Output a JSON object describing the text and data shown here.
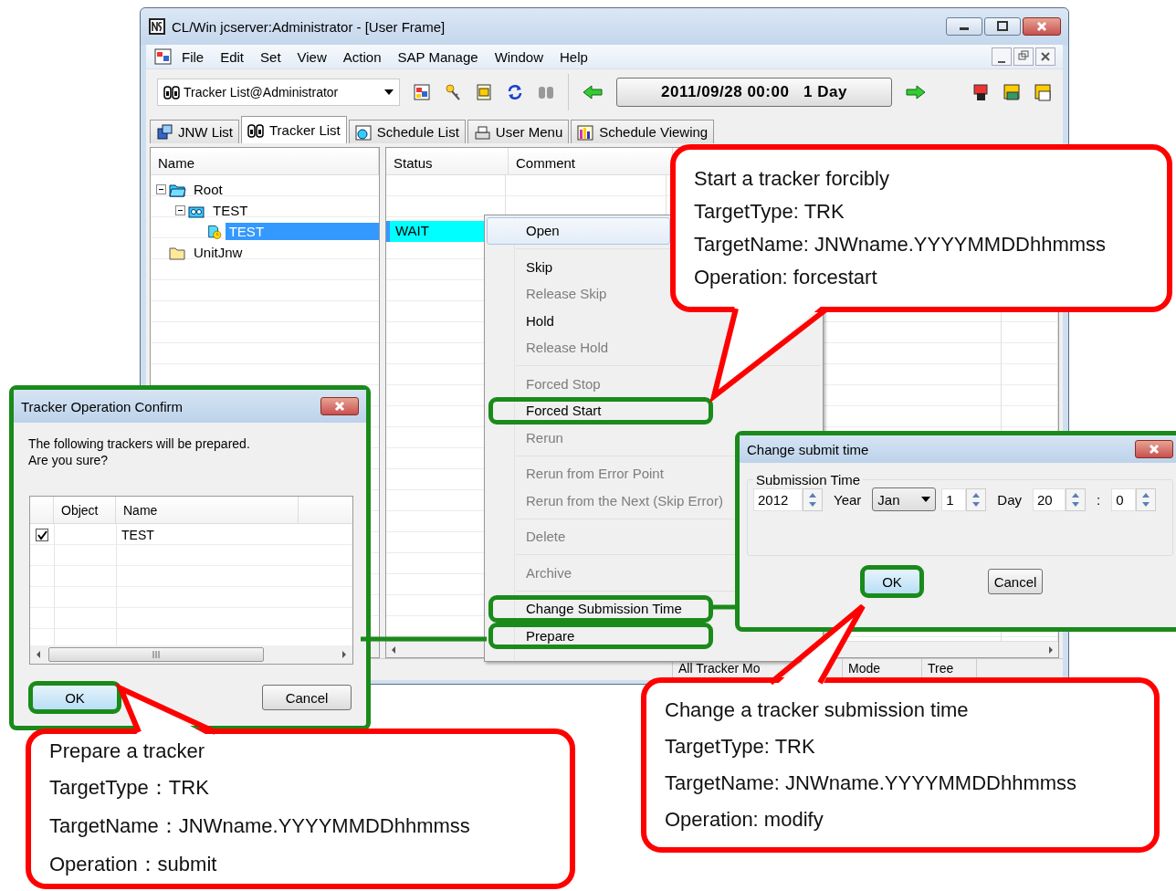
{
  "main_window": {
    "title": "CL/Win jcserver:Administrator - [User Frame]",
    "menu": [
      "File",
      "Edit",
      "Set",
      "View",
      "Action",
      "SAP Manage",
      "Window",
      "Help"
    ],
    "view_selector": "Tracker List@Administrator",
    "date_range": "2011/09/28 00:00   1 Day",
    "tabs": [
      {
        "label": "JNW List",
        "selected": false
      },
      {
        "label": "Tracker List",
        "selected": true
      },
      {
        "label": "Schedule List",
        "selected": false
      },
      {
        "label": "User Menu",
        "selected": false
      },
      {
        "label": "Schedule Viewing",
        "selected": false
      }
    ],
    "tree_column": "Name",
    "tree": [
      {
        "label": "Root",
        "kind": "root",
        "expanded": true,
        "selected": false,
        "children": [
          {
            "label": "TEST",
            "kind": "group",
            "expanded": true,
            "selected": false,
            "children": [
              {
                "label": "TEST",
                "kind": "tracker",
                "selected": true,
                "status": "WAIT"
              }
            ]
          }
        ]
      },
      {
        "label": "UnitJnw",
        "kind": "folder",
        "selected": false
      }
    ],
    "list_columns": [
      "Status",
      "Comment"
    ],
    "status_bar": [
      "All Tracker Mo",
      "Mode",
      "Tree"
    ]
  },
  "context_menu": {
    "items": [
      {
        "kind": "item",
        "label": "Open",
        "selected": true,
        "disabled": false,
        "marked": false
      },
      {
        "kind": "separator"
      },
      {
        "kind": "item",
        "label": "Skip",
        "selected": false,
        "disabled": false,
        "marked": false
      },
      {
        "kind": "item",
        "label": "Release Skip",
        "selected": false,
        "disabled": true,
        "marked": false
      },
      {
        "kind": "item",
        "label": "Hold",
        "selected": false,
        "disabled": false,
        "marked": false
      },
      {
        "kind": "item",
        "label": "Release Hold",
        "selected": false,
        "disabled": true,
        "marked": false
      },
      {
        "kind": "separator"
      },
      {
        "kind": "item",
        "label": "Forced Stop",
        "selected": false,
        "disabled": true,
        "marked": false
      },
      {
        "kind": "item",
        "label": "Forced Start",
        "selected": false,
        "disabled": false,
        "marked": true
      },
      {
        "kind": "item",
        "label": "Rerun",
        "selected": false,
        "disabled": true,
        "marked": false
      },
      {
        "kind": "separator"
      },
      {
        "kind": "item",
        "label": "Rerun from Error Point",
        "selected": false,
        "disabled": true,
        "marked": false
      },
      {
        "kind": "item",
        "label": "Rerun from the Next (Skip Error)",
        "selected": false,
        "disabled": true,
        "marked": false
      },
      {
        "kind": "separator"
      },
      {
        "kind": "item",
        "label": "Delete",
        "selected": false,
        "disabled": true,
        "marked": false
      },
      {
        "kind": "separator"
      },
      {
        "kind": "item",
        "label": "Archive",
        "selected": false,
        "disabled": true,
        "marked": false
      },
      {
        "kind": "separator"
      },
      {
        "kind": "item",
        "label": "Change Submission Time",
        "selected": false,
        "disabled": false,
        "marked": true
      },
      {
        "kind": "item",
        "label": "Prepare",
        "selected": false,
        "disabled": false,
        "marked": true
      }
    ]
  },
  "confirm_dialog": {
    "title": "Tracker Operation Confirm",
    "message": "The following trackers will be prepared.\nAre you sure?",
    "columns": [
      "Object",
      "Name"
    ],
    "rows": [
      {
        "checked": true,
        "name": "TEST"
      }
    ],
    "ok": {
      "label": "OK",
      "marked": true
    },
    "cancel": {
      "label": "Cancel",
      "marked": false
    }
  },
  "time_dialog": {
    "title": "Change submit time",
    "group": "Submission Time",
    "fields": [
      {
        "kind": "spin",
        "value": "2012"
      },
      {
        "kind": "label",
        "text": "Year"
      },
      {
        "kind": "combo",
        "value": "Jan"
      },
      {
        "kind": "spin",
        "value": "1"
      },
      {
        "kind": "label",
        "text": "Day"
      },
      {
        "kind": "spin",
        "value": "20"
      },
      {
        "kind": "label",
        "text": ":"
      },
      {
        "kind": "spin",
        "value": "0"
      }
    ],
    "ok": {
      "label": "OK",
      "marked": true
    },
    "cancel": {
      "label": "Cancel",
      "marked": false
    }
  },
  "callouts": [
    {
      "lines": [
        "Start a tracker forcibly",
        "TargetType: TRK",
        "TargetName: JNWname.YYYYMMDDhhmmss",
        "Operation: forcestart"
      ]
    },
    {
      "lines": [
        "Prepare a tracker",
        "TargetType：TRK",
        "TargetName：JNWname.YYYYMMDDhhmmss",
        "Operation：submit"
      ]
    },
    {
      "lines": [
        "Change a tracker submission time",
        "TargetType: TRK",
        "TargetName: JNWname.YYYYMMDDhhmmss",
        "Operation: modify"
      ]
    }
  ]
}
